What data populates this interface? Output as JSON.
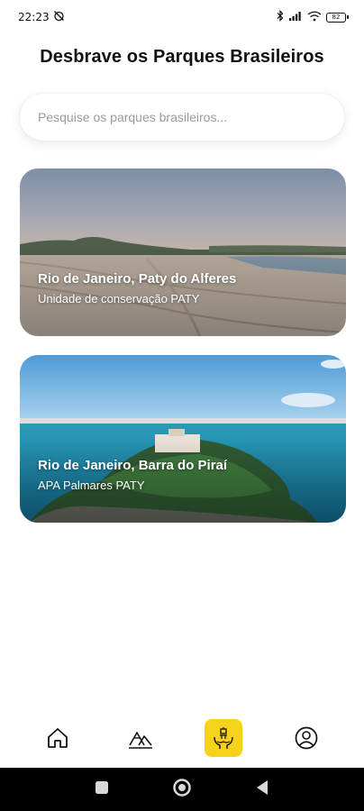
{
  "status_bar": {
    "time": "22:23",
    "battery": "82"
  },
  "header": {
    "title": "Desbrave os Parques Brasileiros"
  },
  "search": {
    "placeholder": "Pesquise os parques brasileiros..."
  },
  "parks": [
    {
      "title": "Rio de Janeiro, Paty do Alferes",
      "subtitle": "Unidade de conservação PATY"
    },
    {
      "title": "Rio de Janeiro, Barra do Piraí",
      "subtitle": "APA Palmares PATY"
    }
  ],
  "bottom_nav": {
    "items": [
      {
        "icon": "home-icon"
      },
      {
        "icon": "mountain-icon"
      },
      {
        "icon": "conservation-icon",
        "active": true
      },
      {
        "icon": "profile-icon"
      }
    ],
    "active_color": "#f6d21b"
  },
  "colors": {
    "accent": "#f6d21b",
    "text": "#111111"
  }
}
